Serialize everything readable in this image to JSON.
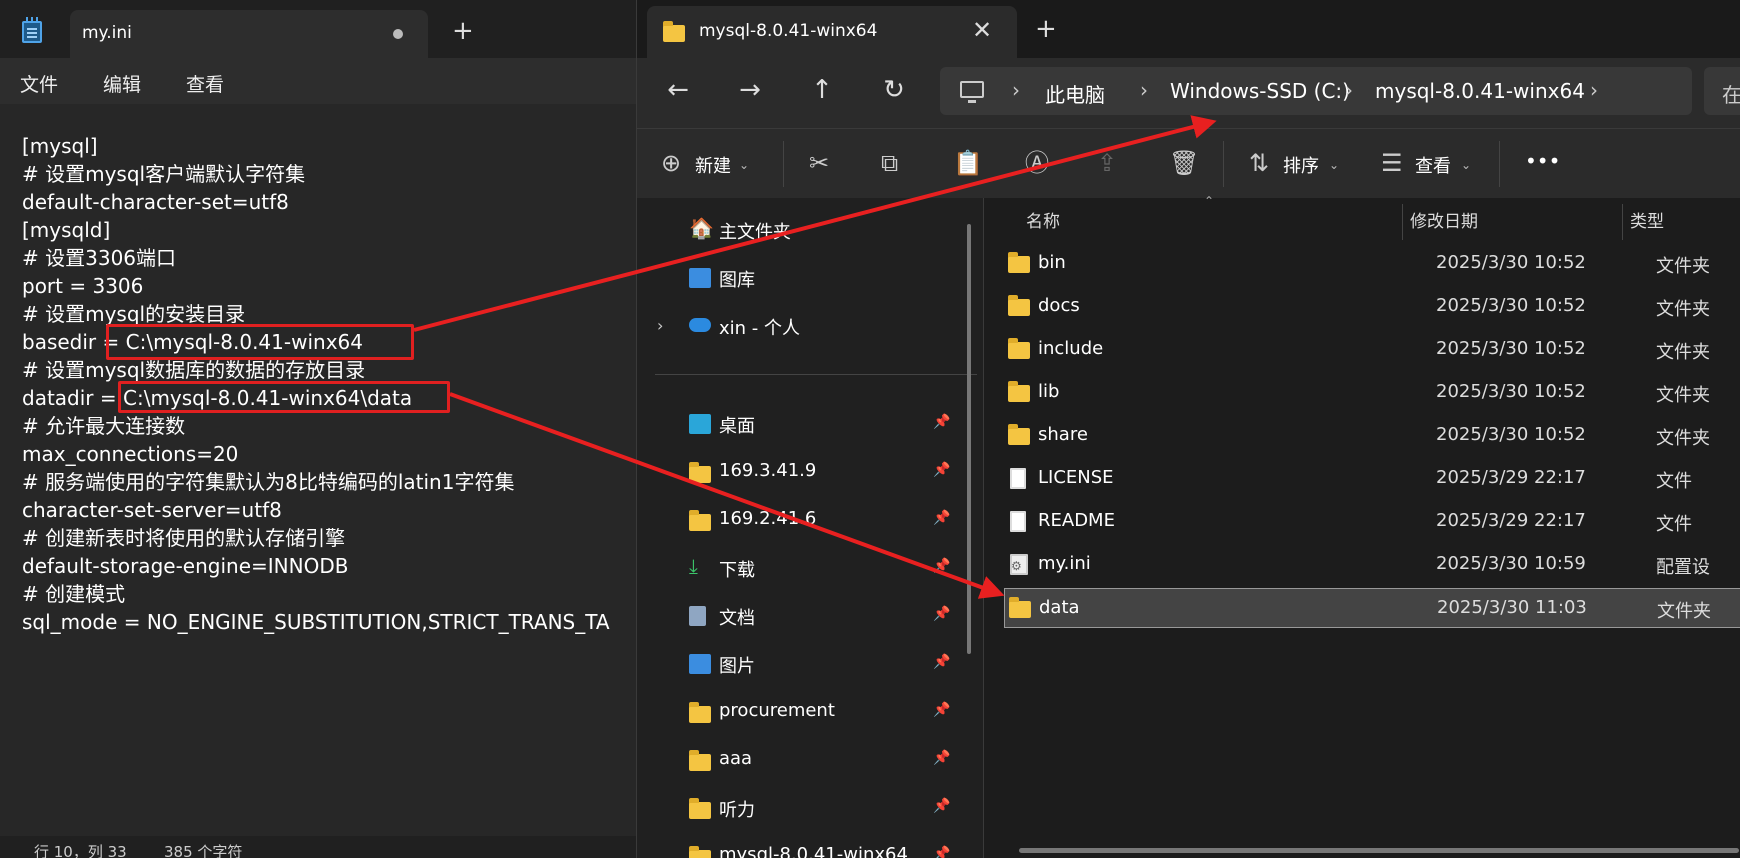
{
  "notepad": {
    "tab_title": "my.ini",
    "menu": [
      "文件",
      "编辑",
      "查看"
    ],
    "lines": [
      "[mysql]",
      "# 设置mysql客户端默认字符集",
      "default-character-set=utf8",
      "[mysqld]",
      "# 设置3306端口",
      "port = 3306",
      "# 设置mysql的安装目录",
      "basedir = C:\\mysql-8.0.41-winx64",
      "# 设置mysql数据库的数据的存放目录",
      "datadir = C:\\mysql-8.0.41-winx64\\data",
      "# 允许最大连接数",
      "max_connections=20",
      "# 服务端使用的字符集默认为8比特编码的latin1字符集",
      "character-set-server=utf8",
      "# 创建新表时将使用的默认存储引擎",
      "default-storage-engine=INNODB",
      "# 创建模式",
      "sql_mode = NO_ENGINE_SUBSTITUTION,STRICT_TRANS_TA"
    ],
    "status": {
      "position": "行 10，列 33",
      "chars": "385 个字符"
    }
  },
  "explorer": {
    "tab_title": "mysql-8.0.41-winx64",
    "address": [
      "此电脑",
      "Windows-SSD (C:)",
      "mysql-8.0.41-winx64"
    ],
    "search_text": "在",
    "toolbar": {
      "new_label": "新建",
      "sort_label": "排序",
      "view_label": "查看",
      "more_label": "•••"
    },
    "nav_items": [
      {
        "label": "主文件夹",
        "icon": "home-icon"
      },
      {
        "label": "图库",
        "icon": "gallery-icon"
      },
      {
        "label": "xin - 个人",
        "icon": "onedrive-icon"
      },
      {
        "label": "桌面",
        "icon": "desktop-icon"
      },
      {
        "label": "169.3.41.9",
        "icon": "folder-icon"
      },
      {
        "label": "169.2.41.6",
        "icon": "folder-icon"
      },
      {
        "label": "下载",
        "icon": "download-icon"
      },
      {
        "label": "文档",
        "icon": "document-icon"
      },
      {
        "label": "图片",
        "icon": "pictures-icon"
      },
      {
        "label": "procurement",
        "icon": "folder-icon"
      },
      {
        "label": "aaa",
        "icon": "folder-icon"
      },
      {
        "label": "听力",
        "icon": "folder-icon"
      },
      {
        "label": "mysql-8.0.41-winx64",
        "icon": "folder-icon"
      }
    ],
    "columns": [
      "名称",
      "修改日期",
      "类型"
    ],
    "files": [
      {
        "name": "bin",
        "date": "2025/3/30 10:52",
        "type": "文件夹",
        "icon": "folder"
      },
      {
        "name": "docs",
        "date": "2025/3/30 10:52",
        "type": "文件夹",
        "icon": "folder"
      },
      {
        "name": "include",
        "date": "2025/3/30 10:52",
        "type": "文件夹",
        "icon": "folder"
      },
      {
        "name": "lib",
        "date": "2025/3/30 10:52",
        "type": "文件夹",
        "icon": "folder"
      },
      {
        "name": "share",
        "date": "2025/3/30 10:52",
        "type": "文件夹",
        "icon": "folder"
      },
      {
        "name": "LICENSE",
        "date": "2025/3/29 22:17",
        "type": "文件",
        "icon": "file"
      },
      {
        "name": "README",
        "date": "2025/3/29 22:17",
        "type": "文件",
        "icon": "file"
      },
      {
        "name": "my.ini",
        "date": "2025/3/30 10:59",
        "type": "配置设",
        "icon": "config"
      },
      {
        "name": "data",
        "date": "2025/3/30 11:03",
        "type": "文件夹",
        "icon": "folder",
        "selected": true
      }
    ]
  },
  "colors": {
    "annotation": "#e82020",
    "folder": "#f4c542",
    "accent": "#4fa3e8"
  }
}
